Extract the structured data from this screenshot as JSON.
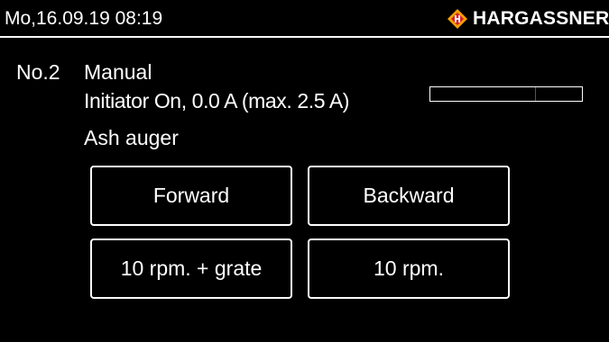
{
  "header": {
    "datetime": "Mo,16.09.19 08:19",
    "brand_name": "HARGASSNER",
    "brand_logo_icon": "hargassner-logo-icon",
    "brand_color": "#f5a000",
    "brand_logo_mark_color": "#d2202a"
  },
  "device": {
    "number": "No.2",
    "mode": "Manual",
    "status": "Initiator On, 0.0 A (max. 2.5 A)",
    "name": "Ash auger",
    "current_a": 0.0,
    "current_max_a": 2.5,
    "current_bar_fraction": 0.0,
    "current_bar_color": "#cc2222"
  },
  "buttons": {
    "forward": "Forward",
    "backward": "Backward",
    "grate": "10 rpm. + grate",
    "rpm": "10 rpm."
  }
}
